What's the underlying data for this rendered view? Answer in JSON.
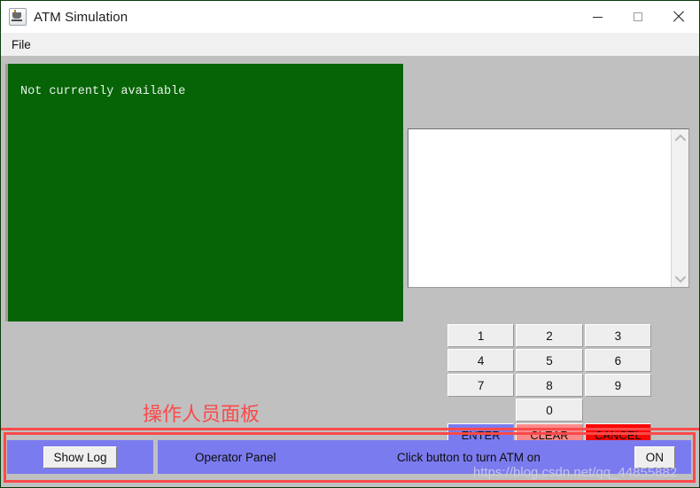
{
  "window": {
    "title": "ATM Simulation",
    "app_icon": "java-coffee-cup-icon",
    "controls": {
      "minimize": "minimize-icon",
      "maximize": "maximize-icon",
      "close": "close-icon"
    }
  },
  "menubar": {
    "items": [
      {
        "label": "File"
      }
    ]
  },
  "customer_display": {
    "text": "Not currently available",
    "background_color": "#066306",
    "text_color": "#e9f3e9"
  },
  "text_area": {
    "value": "",
    "scrollbar": {
      "up_arrow": "chevron-up-icon",
      "down_arrow": "chevron-down-icon"
    }
  },
  "keypad": {
    "rows": [
      [
        {
          "label": "1",
          "kind": "digit"
        },
        {
          "label": "2",
          "kind": "digit"
        },
        {
          "label": "3",
          "kind": "digit"
        }
      ],
      [
        {
          "label": "4",
          "kind": "digit"
        },
        {
          "label": "5",
          "kind": "digit"
        },
        {
          "label": "6",
          "kind": "digit"
        }
      ],
      [
        {
          "label": "7",
          "kind": "digit"
        },
        {
          "label": "8",
          "kind": "digit"
        },
        {
          "label": "9",
          "kind": "digit"
        }
      ],
      [
        {
          "label": "",
          "kind": "empty"
        },
        {
          "label": "0",
          "kind": "digit"
        },
        {
          "label": "",
          "kind": "empty"
        }
      ],
      [
        {
          "label": "ENTER",
          "kind": "enter"
        },
        {
          "label": "CLEAR",
          "kind": "clear"
        },
        {
          "label": "CANCEL",
          "kind": "cancel"
        }
      ]
    ],
    "colors": {
      "enter": "#7b7bf0",
      "clear": "#fa8a8a",
      "cancel": "#fb0606"
    }
  },
  "operator_panel": {
    "show_log_label": "Show Log",
    "panel_label": "Operator Panel",
    "hint": "Click button to turn ATM on",
    "power_button_label": "ON",
    "background_color": "#7b7bf0"
  },
  "annotations": {
    "callout_text": "操作人员面板",
    "callout_color": "#fb4a4a",
    "watermark": "https://blog.csdn.net/qq_44855882"
  }
}
